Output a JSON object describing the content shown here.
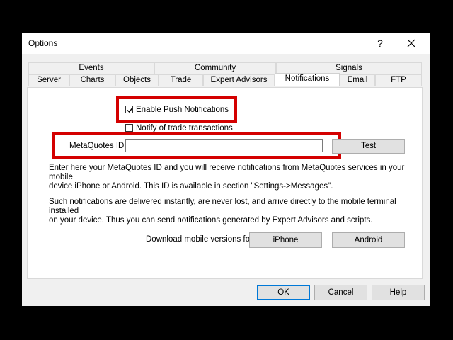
{
  "window": {
    "title": "Options",
    "help_symbol": "?"
  },
  "tabs": {
    "row1": [
      "Events",
      "Community",
      "Signals"
    ],
    "row2": [
      "Server",
      "Charts",
      "Objects",
      "Trade",
      "Expert Advisors",
      "Notifications",
      "Email",
      "FTP"
    ],
    "active": "Notifications"
  },
  "notifications": {
    "enable_push_label": "Enable Push Notifications",
    "enable_push_checked": true,
    "notify_trade_label": "Notify of trade transactions",
    "notify_trade_checked": false,
    "metaquotes_id_label": "MetaQuotes ID",
    "metaquotes_id_value": "",
    "test_button": "Test",
    "info1_line1": "Enter here your MetaQuotes ID and you will receive notifications from MetaQuotes services in your mobile",
    "info1_line2": "device iPhone or Android. This ID is available in section \"Settings->Messages\".",
    "info2_line1": "Such notifications are delivered instantly, are never lost, and arrive directly to the mobile terminal installed",
    "info2_line2": "on your device. Thus you can send notifications generated by Expert Advisors and scripts.",
    "download_label": "Download mobile versions for:",
    "iphone_button": "iPhone",
    "android_button": "Android"
  },
  "footer": {
    "ok": "OK",
    "cancel": "Cancel",
    "help": "Help"
  },
  "colors": {
    "highlight_box": "#d40000",
    "default_button_border": "#0078d7"
  }
}
